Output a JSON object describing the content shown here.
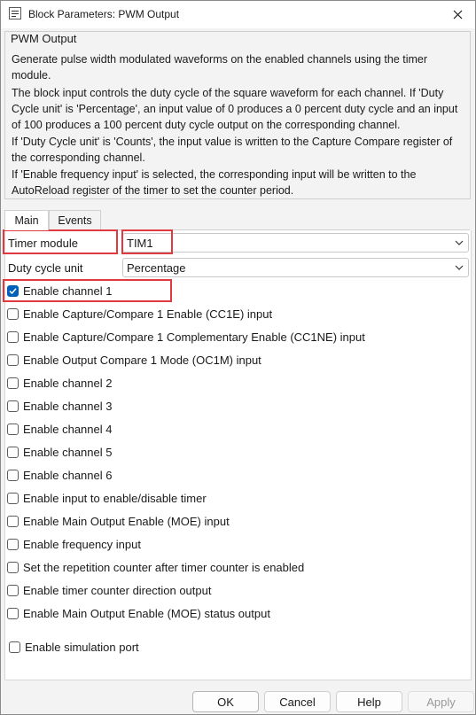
{
  "window": {
    "title": "Block Parameters: PWM Output"
  },
  "group": {
    "title": "PWM Output",
    "paragraphs": [
      "Generate pulse width modulated waveforms on the enabled channels using the timer module.",
      "The block input controls the duty cycle of the square waveform for each channel.  If 'Duty Cycle unit' is 'Percentage', an input value of 0 produces a 0 percent duty cycle and an input of 100 produces a 100 percent duty cycle output on the corresponding channel.",
      "If 'Duty Cycle unit' is 'Counts', the input value is written to the Capture Compare register of the corresponding channel.",
      "If 'Enable frequency input' is selected, the corresponding input will be written to the AutoReload register of the timer to set the counter period."
    ]
  },
  "tabs": [
    {
      "label": "Main",
      "active": true
    },
    {
      "label": "Events",
      "active": false
    }
  ],
  "fields": {
    "timer_module": {
      "label": "Timer module",
      "value": "TIM1"
    },
    "duty_cycle_unit": {
      "label": "Duty cycle unit",
      "value": "Percentage"
    }
  },
  "checkboxes": [
    {
      "label": "Enable channel 1",
      "checked": true
    },
    {
      "label": "Enable Capture/Compare 1 Enable (CC1E) input",
      "checked": false
    },
    {
      "label": "Enable Capture/Compare 1 Complementary Enable (CC1NE) input",
      "checked": false
    },
    {
      "label": "Enable Output Compare 1 Mode (OC1M) input",
      "checked": false
    },
    {
      "label": "Enable channel 2",
      "checked": false
    },
    {
      "label": "Enable channel 3",
      "checked": false
    },
    {
      "label": "Enable channel 4",
      "checked": false
    },
    {
      "label": "Enable channel 5",
      "checked": false
    },
    {
      "label": "Enable channel 6",
      "checked": false
    },
    {
      "label": "Enable input to enable/disable timer",
      "checked": false
    },
    {
      "label": "Enable Main Output Enable (MOE) input",
      "checked": false
    },
    {
      "label": "Enable frequency input",
      "checked": false
    },
    {
      "label": "Set the repetition counter after timer counter is enabled",
      "checked": false
    },
    {
      "label": "Enable timer counter direction output",
      "checked": false
    },
    {
      "label": "Enable Main Output Enable (MOE) status output",
      "checked": false
    }
  ],
  "simulation": {
    "label": "Enable simulation port",
    "checked": false
  },
  "buttons": {
    "ok": "OK",
    "cancel": "Cancel",
    "help": "Help",
    "apply": "Apply"
  },
  "colors": {
    "highlight": "#e0393e",
    "checkbox_checked": "#005fb8"
  }
}
